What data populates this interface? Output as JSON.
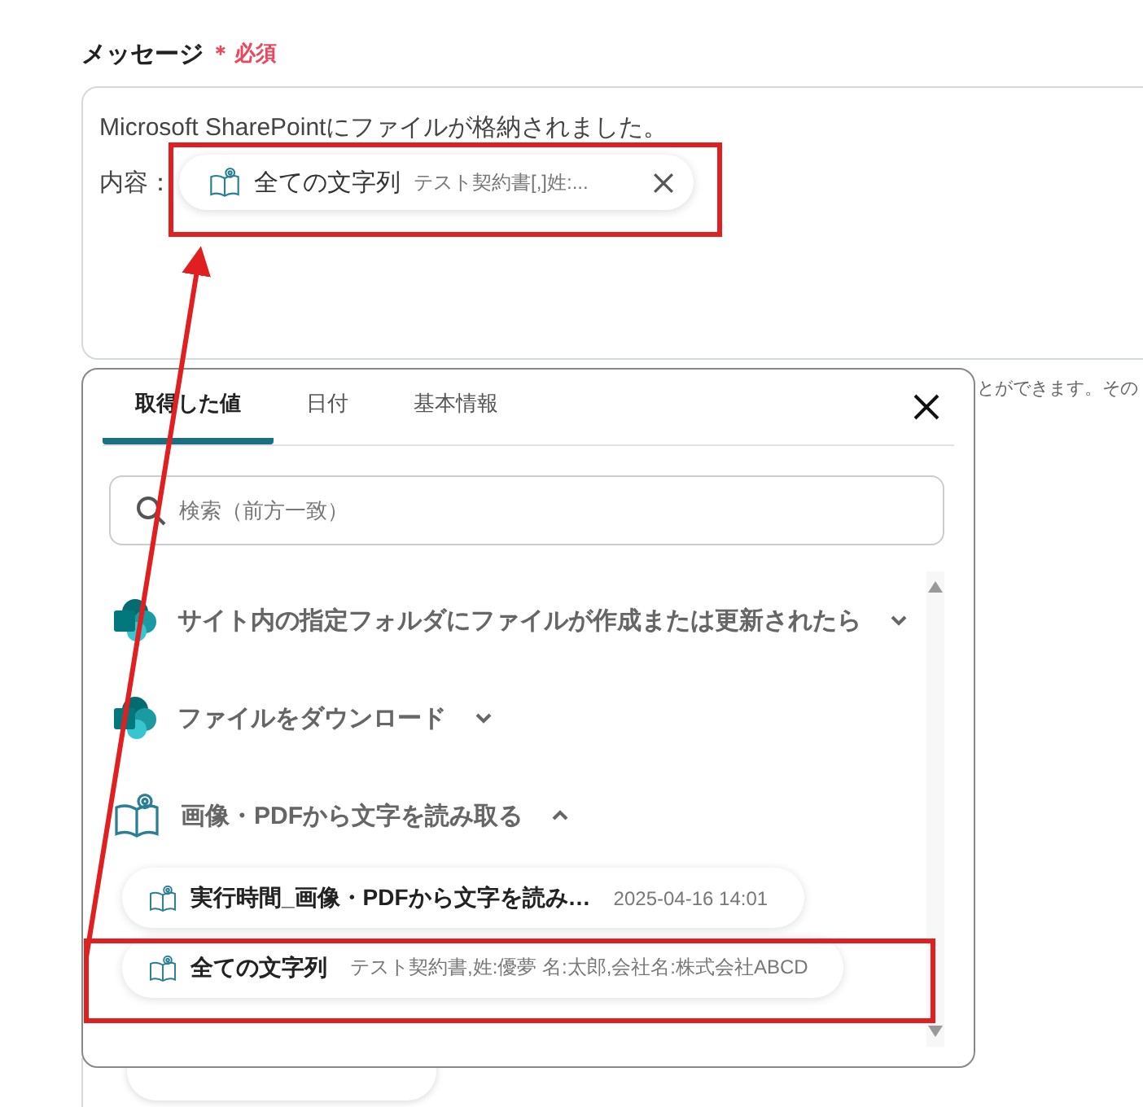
{
  "field": {
    "label": "メッセージ",
    "required_mark": "＊",
    "required_text": "必須"
  },
  "message": {
    "line": "Microsoft SharePointにファイルが格納されました。",
    "prefix": "内容：",
    "chip": {
      "title": "全ての文字列",
      "preview": "テスト契約書[,]姓:..."
    }
  },
  "hint_fragment": "とができます。その",
  "popup": {
    "tabs": [
      {
        "label": "取得した値",
        "selected": true
      },
      {
        "label": "日付",
        "selected": false
      },
      {
        "label": "基本情報",
        "selected": false
      }
    ],
    "search": {
      "placeholder": "検索（前方一致）"
    },
    "groups": [
      {
        "kind": "sharepoint",
        "title": "サイト内の指定フォルダにファイルが作成または更新されたら",
        "expanded": false
      },
      {
        "kind": "sharepoint",
        "title": "ファイルをダウンロード",
        "expanded": false
      },
      {
        "kind": "ocr",
        "title": "画像・PDFから文字を読み取る",
        "expanded": true,
        "children": [
          {
            "title": "実行時間_画像・PDFから文字を読み…",
            "value": "2025-04-16 14:01"
          },
          {
            "title": "全ての文字列",
            "value": "テスト契約書,姓:優夢 名:太郎,会社名:株式会社ABCD"
          }
        ]
      }
    ]
  }
}
